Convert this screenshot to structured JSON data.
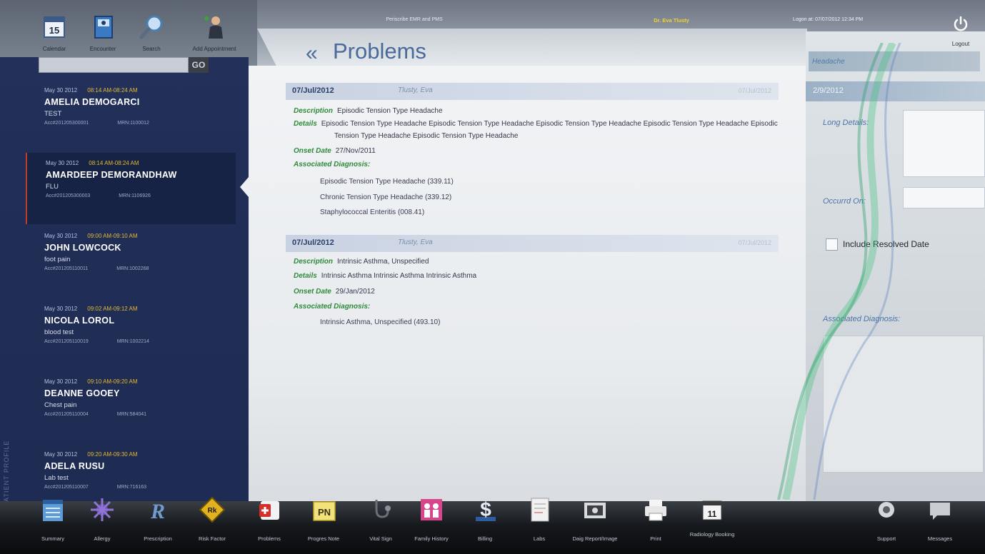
{
  "app": {
    "title": "Periscribe EMR and PMS",
    "doctor": "Dr. Eva Tlusty",
    "login": "Logon at: 07/07/2012 12:34 PM",
    "logout_label": "Logout"
  },
  "toolbar_top": [
    {
      "label": "Calendar",
      "icon": "calendar-icon",
      "badge": "15"
    },
    {
      "label": "Encounter",
      "icon": "encounter-icon"
    },
    {
      "label": "Search",
      "icon": "search-icon"
    },
    {
      "label": "Add Appointment",
      "icon": "add-appointment-icon"
    }
  ],
  "sidebar": {
    "vertical_label": "CUMULATIVE PATIENT PROFILE",
    "search_placeholder": "",
    "go_label": "GO",
    "patients": [
      {
        "date": "May 30 2012",
        "time": "08:14 AM-08:24 AM",
        "name": "AMELIA DEMOGARCI",
        "reason": "TEST",
        "acc": "Acc#201205300001",
        "mrn": "MRN:1100012",
        "selected": false
      },
      {
        "date": "May 30 2012",
        "time": "08:14 AM-08:24 AM",
        "name": "AMARDEEP DEMORANDHAW",
        "reason": "FLU",
        "acc": "Acc#201205300003",
        "mrn": "MRN:1106926",
        "selected": true
      },
      {
        "date": "May 30 2012",
        "time": "09:00 AM-09:10 AM",
        "name": "JOHN LOWCOCK",
        "reason": "foot pain",
        "acc": "Acc#201205110011",
        "mrn": "MRN:1002268",
        "selected": false
      },
      {
        "date": "May 30 2012",
        "time": "09:02 AM-09:12 AM",
        "name": "NICOLA LOROL",
        "reason": "blood test",
        "acc": "Acc#201205110019",
        "mrn": "MRN:1002214",
        "selected": false
      },
      {
        "date": "May 30 2012",
        "time": "09:10 AM-09:20 AM",
        "name": "DEANNE GOOEY",
        "reason": "Chest pain",
        "acc": "Acc#201205110004",
        "mrn": "MRN:584041",
        "selected": false
      },
      {
        "date": "May 30 2012",
        "time": "09:20 AM-09:30 AM",
        "name": "ADELA RUSU",
        "reason": "Lab test",
        "acc": "Acc#201205110007",
        "mrn": "MRN:716163",
        "selected": false
      }
    ]
  },
  "page": {
    "title": "Problems"
  },
  "problems": [
    {
      "date": "07/Jul/2012",
      "doctor": "Tlusty, Eva",
      "right_date": "07/Jul/2012",
      "description_label": "Description",
      "description": "Episodic Tension Type Headache",
      "details_label": "Details",
      "details_line1": "Episodic Tension Type Headache Episodic Tension Type Headache Episodic Tension Type Headache Episodic Tension Type Headache Episodic",
      "details_line2": "Tension Type Headache Episodic Tension Type Headache",
      "onset_label": "Onset Date",
      "onset": "27/Nov/2011",
      "assoc_label": "Associated Diagnosis:",
      "diagnoses": [
        "Episodic Tension Type Headache (339.11)",
        "Chronic Tension Type Headache (339.12)",
        "Staphylococcal Enteritis (008.41)"
      ]
    },
    {
      "date": "07/Jul/2012",
      "doctor": "Tlusty, Eva",
      "right_date": "07/Jul/2012",
      "description_label": "Description",
      "description": "Intrinsic Asthma, Unspecified",
      "details_label": "Details",
      "details_line1": "Intrinsic Asthma Intrinsic Asthma Intrinsic Asthma",
      "details_line2": "",
      "onset_label": "Onset Date",
      "onset": "29/Jan/2012",
      "assoc_label": "Associated Diagnosis:",
      "diagnoses": [
        "Intrinsic Asthma, Unspecified (493.10)"
      ]
    }
  ],
  "right_panel": {
    "search_value": "Headache",
    "date_value": "2/9/2012",
    "long_details_label": "Long Details:",
    "occurred_on_label": "Occurrd On:",
    "include_resolved_label": "Include Resolved Date",
    "assoc_label": "Associated Diagnosis:"
  },
  "toolbar_bottom": [
    {
      "label": "Summary",
      "icon": "summary-icon"
    },
    {
      "label": "Allergy",
      "icon": "allergy-icon"
    },
    {
      "label": "Prescription",
      "icon": "prescription-icon"
    },
    {
      "label": "Risk Factor",
      "icon": "risk-factor-icon"
    },
    {
      "label": "Problems",
      "icon": "problems-icon"
    },
    {
      "label": "Progres Note",
      "icon": "progress-note-icon"
    },
    {
      "label": "Vital Sign",
      "icon": "vital-sign-icon"
    },
    {
      "label": "Family History",
      "icon": "family-history-icon"
    },
    {
      "label": "Billing",
      "icon": "billing-icon"
    },
    {
      "label": "Labs",
      "icon": "labs-icon"
    },
    {
      "label": "Daig Report/Image",
      "icon": "diag-report-icon"
    },
    {
      "label": "Print",
      "icon": "print-icon"
    },
    {
      "label": "Radiology Booking",
      "icon": "radiology-booking-icon"
    },
    {
      "label": "Support",
      "icon": "support-icon"
    },
    {
      "label": "Messages",
      "icon": "messages-icon"
    }
  ],
  "colors": {
    "accent": "#4a6b99",
    "sidebar": "#22305a",
    "highlight": "#e4b830",
    "label_green": "#2f8a3a"
  }
}
